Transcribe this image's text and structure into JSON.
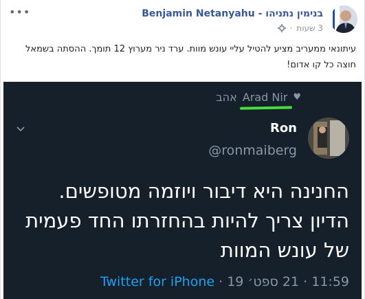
{
  "post": {
    "author": "Benjamin Netanyahu - בנימין נתניהו",
    "time": "3 שעות",
    "more_label": "•••",
    "text": "עיתונאי ממעריב מציע להטיל עליי עונש מוות. ערד ניר מערוץ 12 תומך. ההסתה בשמאל חוצה כל קו אדום!",
    "privacy_icon": "gear-icon"
  },
  "tweet": {
    "liked_by_name": "Arad Nir",
    "liked_word": "אהב",
    "name": "Ron",
    "handle": "@ronmaiberg",
    "body": "החנינה היא דיבור ויוזמה מטופשים. הדיון צריך להיות בהחזרתו החד פעמית של עונש המוות",
    "time": "11:59",
    "date": "21 ספט׳ 19",
    "separator": "·",
    "source": "Twitter for iPhone"
  },
  "colors": {
    "fb_link": "#385898",
    "tweet_bg": "#15202b",
    "tweet_muted": "#8899a6",
    "twitter_blue": "#1da1f2",
    "highlight": "#4ade3a"
  }
}
